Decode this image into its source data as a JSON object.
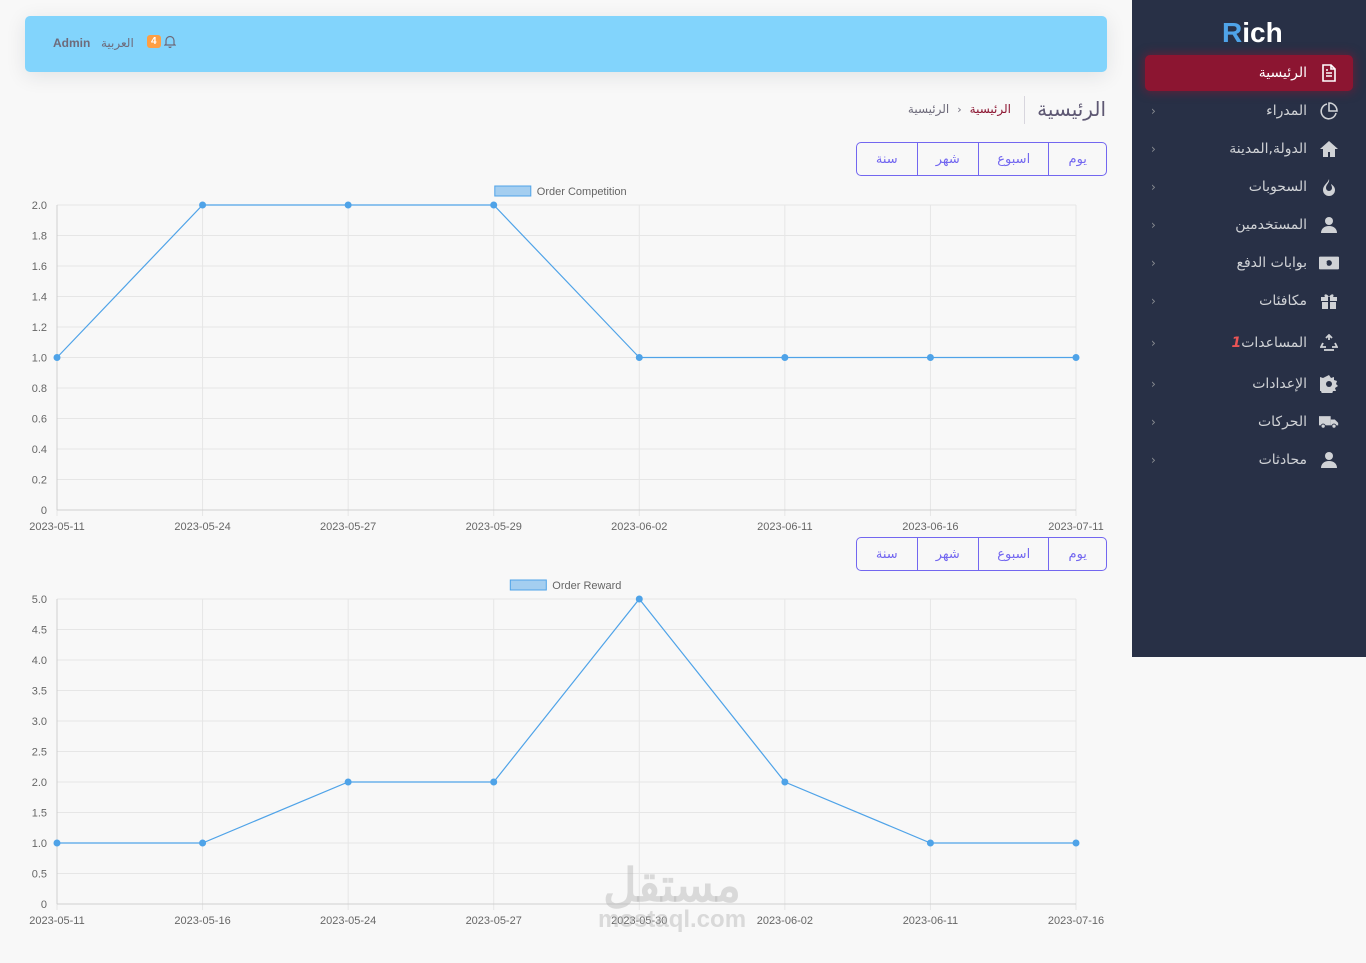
{
  "brand": {
    "name_first": "R",
    "name_rest": "ich"
  },
  "navbar": {
    "user": "Admin",
    "language": "العربية",
    "notif_count": "4"
  },
  "header": {
    "title": "الرئيسية",
    "breadcrumb": [
      "الرئيسية",
      "الرئيسية"
    ]
  },
  "sidebar": {
    "items": [
      {
        "label": "الرئيسية",
        "icon": "file-text-icon",
        "active": true
      },
      {
        "label": "المدراء",
        "icon": "pie-chart-icon"
      },
      {
        "label": "الدولة,المدينة",
        "icon": "home-icon"
      },
      {
        "label": "السحوبات",
        "icon": "fire-icon"
      },
      {
        "label": "المستخدمين",
        "icon": "user-icon"
      },
      {
        "label": "بوابات الدفع",
        "icon": "money-bill-icon"
      },
      {
        "label": "مكافئات",
        "icon": "gift-icon"
      },
      {
        "label": "المساعدات",
        "badge": "1",
        "icon": "recycle-icon"
      },
      {
        "label": "الإعدادات",
        "icon": "gear-icon"
      },
      {
        "label": "الحركات",
        "icon": "truck-icon"
      },
      {
        "label": "محادثات",
        "icon": "user-icon"
      }
    ]
  },
  "period_buttons": [
    "يوم",
    "اسبوع",
    "شهر",
    "سنة"
  ],
  "watermark": {
    "ar": "مستقل",
    "en": "mostaql.com"
  },
  "chart_data": [
    {
      "type": "line",
      "title": "",
      "series": [
        {
          "name": "Order Competition",
          "values": [
            1,
            2,
            2,
            2,
            1,
            1,
            1,
            1
          ]
        }
      ],
      "categories": [
        "2023-05-11",
        "2023-05-24",
        "2023-05-27",
        "2023-05-29",
        "2023-06-02",
        "2023-06-11",
        "2023-06-16",
        "2023-07-11"
      ],
      "ylim": [
        0,
        2
      ],
      "yticks": [
        "0",
        "0.2",
        "0.4",
        "0.6",
        "0.8",
        "1.0",
        "1.2",
        "1.4",
        "1.6",
        "1.8",
        "2.0"
      ],
      "grid": true,
      "legend": "top-center",
      "color": "#4fa3e8"
    },
    {
      "type": "line",
      "title": "",
      "series": [
        {
          "name": "Order Reward",
          "values": [
            1,
            1,
            2,
            2,
            5,
            2,
            1,
            1
          ]
        }
      ],
      "categories": [
        "2023-05-11",
        "2023-05-16",
        "2023-05-24",
        "2023-05-27",
        "2023-05-30",
        "2023-06-02",
        "2023-06-11",
        "2023-07-16"
      ],
      "ylim": [
        0,
        5
      ],
      "yticks": [
        "0",
        "0.5",
        "1.0",
        "1.5",
        "2.0",
        "2.5",
        "3.0",
        "3.5",
        "4.0",
        "4.5",
        "5.0"
      ],
      "grid": true,
      "legend": "top-center",
      "color": "#4fa3e8"
    }
  ]
}
